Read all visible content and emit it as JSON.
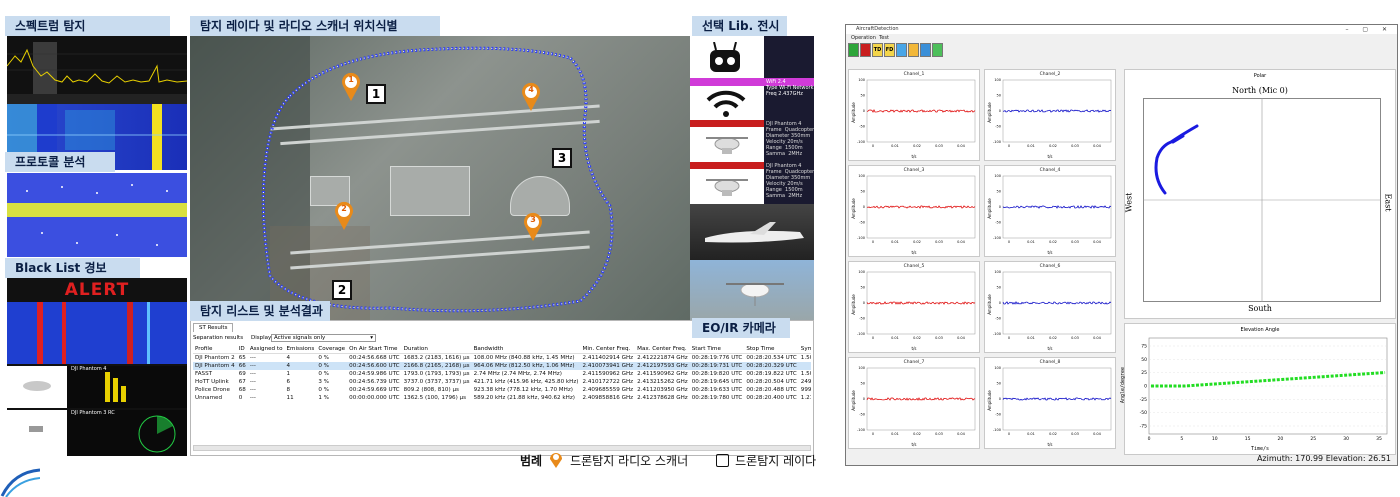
{
  "left": {
    "spectrum_title": "스펙트럼 탐지",
    "protocol_title": "프로토콜 분석",
    "blacklist_title": "Black List 경보",
    "alert_text": "ALERT",
    "bl_entries": [
      "DJI Phantom 4",
      "DJI Phantom 3 RC"
    ]
  },
  "map": {
    "title": "탐지 레이다 및 라디오 스캐너 위치식별",
    "pins": [
      "1",
      "2",
      "3",
      "4"
    ],
    "boxes": [
      "1",
      "2",
      "3"
    ]
  },
  "lib": {
    "title": "선택 Lib. 전시",
    "eo_title": "EO/IR 카메라",
    "cards": [
      "WiFi 2.4\nType Wi-Fi Network\nFreq 2.437GHz",
      "DJI Phantom 4\nFrame  Quadcopter\nDiameter 350mm\nVelocity 20m/s\nRange  1500m\nSamma  2MHz",
      "DJI Phantom 4\nFrame  Quadcopter\nDiameter 350mm\nVelocity 20m/s\nRange  1500m\nSamma  2MHz"
    ]
  },
  "list": {
    "title": "탐지 리스트 및 분석결과",
    "tab": "ST Results",
    "sep_label": "Separation results",
    "display_label": "Display",
    "display_value": "Active signals only",
    "columns": [
      "Profile",
      "ID",
      "Assigned to",
      "Emissions",
      "Coverage",
      "On Air Start Time",
      "Duration",
      "Bandwidth",
      "Min. Center Freq.",
      "Max. Center Freq.",
      "Start Time",
      "Stop Time",
      "Symb"
    ],
    "rows": [
      [
        "DJI Phantom 2",
        "65",
        "---",
        "4",
        "0 %",
        "00:24:56.668 UTC",
        "1683.2 (2183, 1616) µs",
        "108.00 MHz (840.88 kHz, 1.45 MHz)",
        "2.411402914 GHz",
        "2.412221874 GHz",
        "00:28:19:776 UTC",
        "00:28:20.534 UTC",
        "1.50000"
      ],
      [
        "DJI Phantom 4",
        "66",
        "---",
        "4",
        "0 %",
        "00:24:56.600 UTC",
        "2166.8 (2165, 2168) µs",
        "964.06 MHz (812.50 kHz, 1.06 MHz)",
        "2.410073941 GHz",
        "2.412197593 GHz",
        "00:28:19:731 UTC",
        "00:28:20.329 UTC",
        ""
      ],
      [
        "FASST",
        "69",
        "---",
        "1",
        "0 %",
        "00:24:59.986 UTC",
        "1793.0 (1793, 1793) µs",
        "2.74 MHz (2.74 MHz, 2.74 MHz)",
        "2.411590962 GHz",
        "2.411590962 GHz",
        "00:28:19:820 UTC",
        "00:28:19.822 UTC",
        "1.50000"
      ],
      [
        "HoTT Uplink",
        "67",
        "---",
        "6",
        "3 %",
        "00:24:56.739 UTC",
        "3737.0 (3737, 3737) µs",
        "421.71 kHz (415.96 kHz, 425.80 kHz)",
        "2.410172722 GHz",
        "2.413215262 GHz",
        "00:28:19:645 UTC",
        "00:28:20.504 UTC",
        "249.9"
      ],
      [
        "Police Drone",
        "68",
        "---",
        "8",
        "0 %",
        "00:24:59.669 UTC",
        "809.2 (808, 810) µs",
        "923.38 kHz (778.12 kHz, 1.70 MHz)",
        "2.409685559 GHz",
        "2.411203950 GHz",
        "00:28:19:633 UTC",
        "00:28:20.488 UTC",
        "999.9"
      ],
      [
        "Unnamed",
        "0",
        "---",
        "11",
        "1 %",
        "00:00:00.000 UTC",
        "1362.5 (100, 1796) µs",
        "589.20 kHz (21.88 kHz, 940.62 kHz)",
        "2.409858816 GHz",
        "2.412378628 GHz",
        "00:28:19:780 UTC",
        "00:28:20.400 UTC",
        "1.2137"
      ]
    ]
  },
  "legend": {
    "label": "범례",
    "scanner": "드론탐지 라디오 스캐너",
    "radar": "드론탐지 레이다"
  },
  "app": {
    "window_title": "AircraftDetection",
    "menu": [
      "Operation",
      "Test"
    ],
    "toolbar": [
      "TD",
      "FD"
    ],
    "channels": [
      "Chanel_1",
      "Chanel_2",
      "Chanel_3",
      "Chanel_4",
      "Chanel_5",
      "Chanel_6",
      "Chanel_7",
      "Chanel_8"
    ],
    "channel_ylabel": "Amplitude",
    "channel_xlabel": "t/s",
    "channel_xticks": [
      "0",
      "0.01",
      "0.02",
      "0.03",
      "0.04"
    ],
    "channel_yticks": [
      "100",
      "50",
      "0",
      "-50",
      "-100"
    ],
    "polar": {
      "title": "Polar",
      "north": "North (Mic 0)",
      "south": "South",
      "west": "West",
      "east": "East"
    },
    "elevation": {
      "title": "Elevation Angle",
      "ylabel": "Angle/degree",
      "xlabel": "Time/s",
      "xticks": [
        "0",
        "5",
        "10",
        "15",
        "20",
        "25",
        "30",
        "35"
      ],
      "yticks": [
        "75",
        "50",
        "25",
        "0",
        "-25",
        "-50",
        "-75"
      ]
    },
    "status": "Azimuth: 170.99  Elevation: 26.51",
    "colors": {
      "channel_red": "#e01010",
      "channel_blue": "#1010c8",
      "elev_green": "#22dd22",
      "polar_blue": "#1a1ae0"
    }
  }
}
